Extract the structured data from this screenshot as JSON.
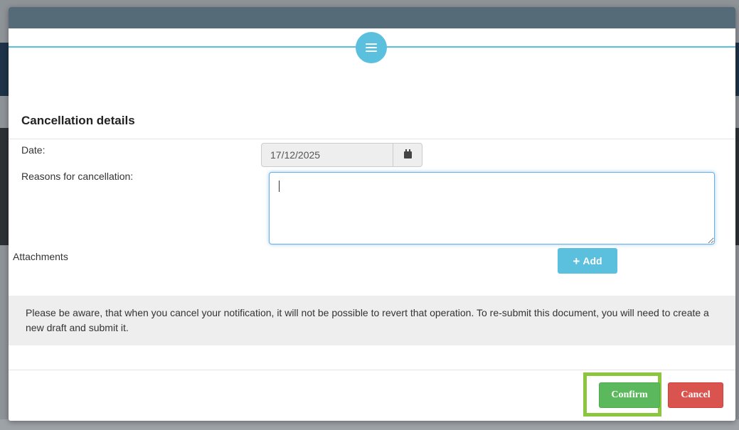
{
  "modal": {
    "section_title": "Cancellation details",
    "date_label": "Date:",
    "date_value": "17/12/2025",
    "reasons_label": "Reasons for cancellation:",
    "reasons_value": "",
    "attachments_label": "Attachments",
    "add_label": "Add",
    "notice": "Please be aware, that when you cancel your notification, it will not be possible to revert that operation. To re-submit this document, you will need to create a new draft and submit it.",
    "confirm_label": "Confirm",
    "cancel_label": "Cancel"
  },
  "icons": {
    "menu": "menu-icon",
    "calendar": "calendar-icon",
    "add": "plus-icon"
  },
  "colors": {
    "header": "#566b78",
    "accent": "#5bc0de",
    "confirm": "#5cb85c",
    "cancel": "#d9534f",
    "highlight": "#8cc63f"
  }
}
